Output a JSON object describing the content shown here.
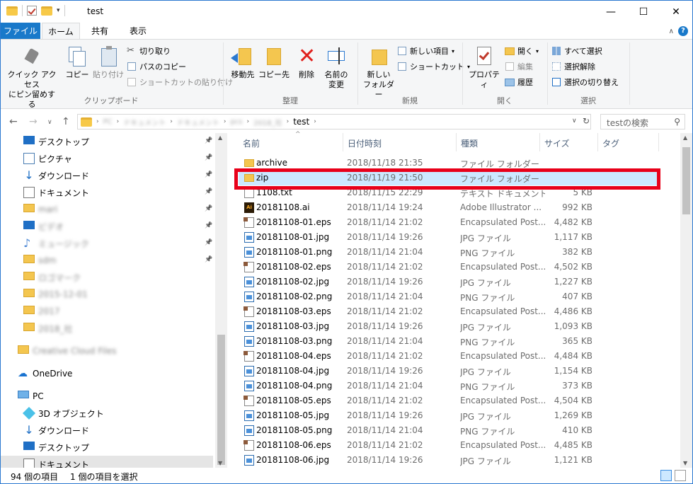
{
  "window": {
    "title": "test",
    "minimize_glyph": "—",
    "maximize_glyph": "☐",
    "close_glyph": "✕"
  },
  "ribbon_tabs": [
    "ファイル",
    "ホーム",
    "共有",
    "表示"
  ],
  "ribbon": {
    "clipboard": {
      "label": "クリップボード",
      "pin_quick": "クイック アクセス\nにピン留めする",
      "copy": "コピー",
      "paste": "貼り付け",
      "cut": "切り取り",
      "copy_path": "パスのコピー",
      "paste_shortcut": "ショートカットの貼り付け"
    },
    "organize": {
      "label": "整理",
      "move_to": "移動先",
      "copy_to": "コピー先",
      "delete": "削除",
      "rename": "名前の\n変更"
    },
    "new": {
      "label": "新規",
      "new_folder": "新しい\nフォルダー",
      "new_item": "新しい項目",
      "easy_access": "ショートカット"
    },
    "open": {
      "label": "開く",
      "properties": "プロパティ",
      "open": "開く",
      "edit": "編集",
      "history": "履歴"
    },
    "select": {
      "label": "選択",
      "select_all": "すべて選択",
      "select_none": "選択解除",
      "invert": "選択の切り替え"
    }
  },
  "address": {
    "blurred_crumbs": [
      "PC",
      "ドキュメント",
      "ドキュメント",
      "pcs",
      "2018_社"
    ],
    "current": "test",
    "search_placeholder": "testの検索"
  },
  "nav": {
    "quick_access": [
      {
        "label": "デスクトップ",
        "icon": "desktop-icon",
        "pinned": true
      },
      {
        "label": "ピクチャ",
        "icon": "pictures-icon",
        "pinned": true
      },
      {
        "label": "ダウンロード",
        "icon": "download-icon",
        "pinned": true
      },
      {
        "label": "ドキュメント",
        "icon": "documents-icon",
        "pinned": true
      },
      {
        "label": "mari",
        "icon": "folder-icon",
        "pinned": true,
        "blurred": true
      },
      {
        "label": "ビデオ",
        "icon": "video-icon",
        "pinned": true,
        "blurred": true
      },
      {
        "label": "ミュージック",
        "icon": "music-icon",
        "pinned": true,
        "blurred": true
      },
      {
        "label": "sdm",
        "icon": "folder-icon",
        "pinned": true,
        "blurred": true
      },
      {
        "label": "ロゴマーク",
        "icon": "folder-icon",
        "pinned": false,
        "blurred": true
      },
      {
        "label": "2015-12-01",
        "icon": "folder-icon",
        "pinned": false,
        "blurred": true
      },
      {
        "label": "2017",
        "icon": "folder-icon",
        "pinned": false,
        "blurred": true
      },
      {
        "label": "2018_社",
        "icon": "folder-icon",
        "pinned": false,
        "blurred": true
      }
    ],
    "creative_cloud": "Creative Cloud Files",
    "onedrive": "OneDrive",
    "pc": "PC",
    "pc_items": [
      {
        "label": "3D オブジェクト",
        "icon": "3d-objects-icon"
      },
      {
        "label": "ダウンロード",
        "icon": "download-icon"
      },
      {
        "label": "デスクトップ",
        "icon": "desktop-icon"
      },
      {
        "label": "ドキュメント",
        "icon": "documents-icon"
      }
    ]
  },
  "columns": [
    "名前",
    "日付時刻",
    "種類",
    "サイズ",
    "タグ"
  ],
  "files": [
    {
      "name": "archive",
      "date": "2018/11/18 21:35",
      "type": "ファイル フォルダー",
      "size": "",
      "icon": "folder"
    },
    {
      "name": "zip",
      "date": "2018/11/19 21:50",
      "type": "ファイル フォルダー",
      "size": "",
      "icon": "folder"
    },
    {
      "name": "1108.txt",
      "date": "2018/11/15 22:29",
      "type": "テキスト ドキュメント",
      "size": "5 KB",
      "icon": "txt"
    },
    {
      "name": "20181108.ai",
      "date": "2018/11/14 19:24",
      "type": "Adobe Illustrator ...",
      "size": "992 KB",
      "icon": "ai"
    },
    {
      "name": "20181108-01.eps",
      "date": "2018/11/14 21:02",
      "type": "Encapsulated Post...",
      "size": "4,482 KB",
      "icon": "eps"
    },
    {
      "name": "20181108-01.jpg",
      "date": "2018/11/14 19:26",
      "type": "JPG ファイル",
      "size": "1,117 KB",
      "icon": "img"
    },
    {
      "name": "20181108-01.png",
      "date": "2018/11/14 21:04",
      "type": "PNG ファイル",
      "size": "382 KB",
      "icon": "img"
    },
    {
      "name": "20181108-02.eps",
      "date": "2018/11/14 21:02",
      "type": "Encapsulated Post...",
      "size": "4,502 KB",
      "icon": "eps"
    },
    {
      "name": "20181108-02.jpg",
      "date": "2018/11/14 19:26",
      "type": "JPG ファイル",
      "size": "1,227 KB",
      "icon": "img"
    },
    {
      "name": "20181108-02.png",
      "date": "2018/11/14 21:04",
      "type": "PNG ファイル",
      "size": "407 KB",
      "icon": "img"
    },
    {
      "name": "20181108-03.eps",
      "date": "2018/11/14 21:02",
      "type": "Encapsulated Post...",
      "size": "4,486 KB",
      "icon": "eps"
    },
    {
      "name": "20181108-03.jpg",
      "date": "2018/11/14 19:26",
      "type": "JPG ファイル",
      "size": "1,093 KB",
      "icon": "img"
    },
    {
      "name": "20181108-03.png",
      "date": "2018/11/14 21:04",
      "type": "PNG ファイル",
      "size": "365 KB",
      "icon": "img"
    },
    {
      "name": "20181108-04.eps",
      "date": "2018/11/14 21:02",
      "type": "Encapsulated Post...",
      "size": "4,484 KB",
      "icon": "eps"
    },
    {
      "name": "20181108-04.jpg",
      "date": "2018/11/14 19:26",
      "type": "JPG ファイル",
      "size": "1,154 KB",
      "icon": "img"
    },
    {
      "name": "20181108-04.png",
      "date": "2018/11/14 21:04",
      "type": "PNG ファイル",
      "size": "373 KB",
      "icon": "img"
    },
    {
      "name": "20181108-05.eps",
      "date": "2018/11/14 21:02",
      "type": "Encapsulated Post...",
      "size": "4,504 KB",
      "icon": "eps"
    },
    {
      "name": "20181108-05.jpg",
      "date": "2018/11/14 19:26",
      "type": "JPG ファイル",
      "size": "1,269 KB",
      "icon": "img"
    },
    {
      "name": "20181108-05.png",
      "date": "2018/11/14 21:04",
      "type": "PNG ファイル",
      "size": "410 KB",
      "icon": "img"
    },
    {
      "name": "20181108-06.eps",
      "date": "2018/11/14 21:02",
      "type": "Encapsulated Post...",
      "size": "4,485 KB",
      "icon": "eps"
    },
    {
      "name": "20181108-06.jpg",
      "date": "2018/11/14 19:26",
      "type": "JPG ファイル",
      "size": "1,121 KB",
      "icon": "img"
    }
  ],
  "highlighted_row": "zip",
  "highlight_color": "#e8001a",
  "status": {
    "count": "94 個の項目",
    "selected": "1 個の項目を選択"
  }
}
